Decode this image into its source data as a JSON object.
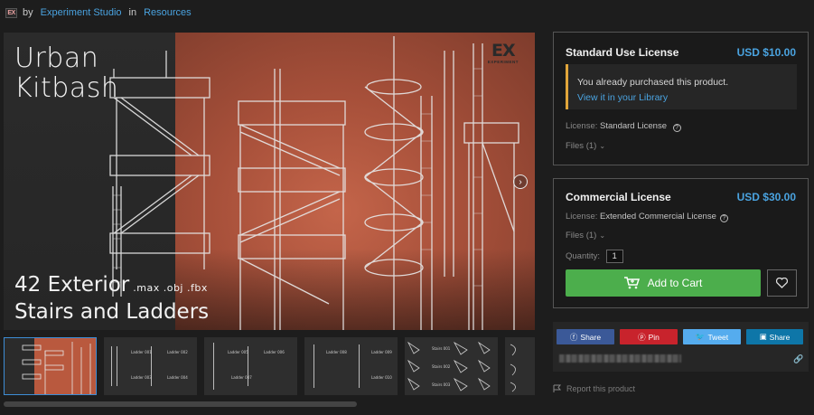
{
  "header": {
    "logo_text": "EX",
    "by": "by",
    "author": "Experiment Studio",
    "in": "in",
    "category": "Resources"
  },
  "hero": {
    "title_line1": "Urban",
    "title_line2": "Kitbash",
    "subtitle_line1": "42 Exterior",
    "formats": ".max .obj .fbx",
    "subtitle_line2": "Stairs and Ladders",
    "brand_mark": "EX",
    "brand_name": "EXPERIMENT"
  },
  "thumbnails": [
    {
      "label": "hero"
    },
    {
      "labels": [
        "Ladder 001",
        "Ladder 002",
        "Ladder 003",
        "Ladder 004"
      ]
    },
    {
      "labels": [
        "Ladder 005",
        "Ladder 006",
        "Ladder 007"
      ]
    },
    {
      "labels": [
        "Ladder 008",
        "Ladder 009",
        "Ladder 010"
      ]
    },
    {
      "labels": [
        "Stairs 001",
        "Stairs 002",
        "Stairs 003"
      ]
    },
    {
      "labels": []
    }
  ],
  "license_standard": {
    "title": "Standard Use License",
    "price": "USD $10.00",
    "notice_text": "You already purchased this product.",
    "notice_link": "View it in your Library",
    "license_label": "License:",
    "license_value": "Standard License",
    "files": "Files (1)"
  },
  "license_commercial": {
    "title": "Commercial License",
    "price": "USD $30.00",
    "license_label": "License:",
    "license_value": "Extended Commercial License",
    "files": "Files (1)",
    "quantity_label": "Quantity:",
    "quantity_value": "1",
    "add_to_cart": "Add to Cart"
  },
  "share": {
    "facebook": "Share",
    "pinterest": "Pin",
    "twitter": "Tweet",
    "linkedin": "Share"
  },
  "report": "Report this product",
  "colors": {
    "accent_blue": "#4aa3e0",
    "cart_green": "#4cae4c",
    "notice_border": "#e1a53a",
    "hero_bg": "#b9593e"
  }
}
